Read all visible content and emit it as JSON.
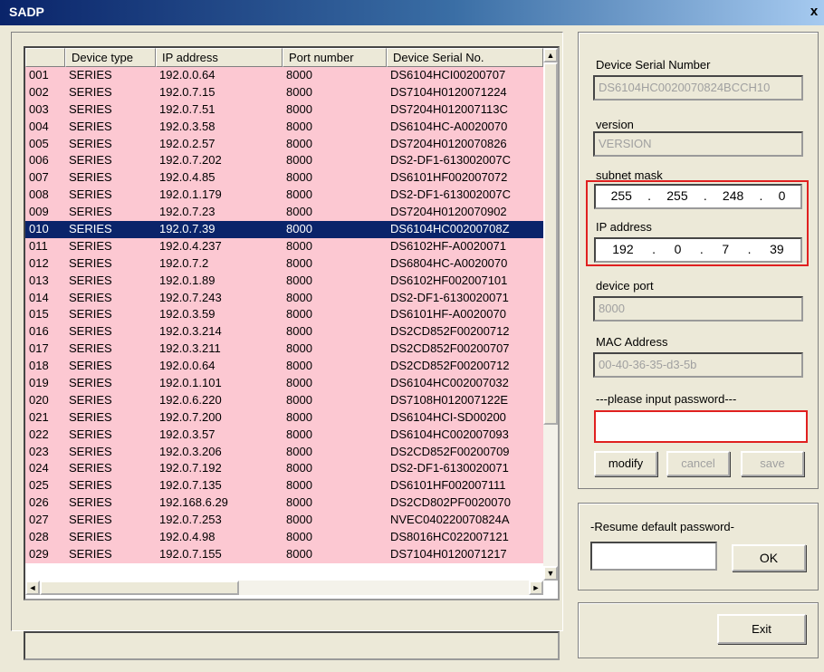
{
  "window": {
    "title": "SADP",
    "close_glyph": "x"
  },
  "table": {
    "columns": [
      "",
      "Device type",
      "IP address",
      "Port number",
      "Device Serial No."
    ],
    "rows": [
      [
        "001",
        "SERIES",
        "192.0.0.64",
        "8000",
        "DS6104HCI00200707"
      ],
      [
        "002",
        "SERIES",
        "192.0.7.15",
        "8000",
        "DS7104H0120071224"
      ],
      [
        "003",
        "SERIES",
        "192.0.7.51",
        "8000",
        "DS7204H012007113C"
      ],
      [
        "004",
        "SERIES",
        "192.0.3.58",
        "8000",
        "DS6104HC-A0020070"
      ],
      [
        "005",
        "SERIES",
        "192.0.2.57",
        "8000",
        "DS7204H0120070826"
      ],
      [
        "006",
        "SERIES",
        "192.0.7.202",
        "8000",
        "DS2-DF1-613002007C"
      ],
      [
        "007",
        "SERIES",
        "192.0.4.85",
        "8000",
        "DS6101HF002007072"
      ],
      [
        "008",
        "SERIES",
        "192.0.1.179",
        "8000",
        "DS2-DF1-613002007C"
      ],
      [
        "009",
        "SERIES",
        "192.0.7.23",
        "8000",
        "DS7204H0120070902"
      ],
      [
        "010",
        "SERIES",
        "192.0.7.39",
        "8000",
        "DS6104HC00200708Z"
      ],
      [
        "011",
        "SERIES",
        "192.0.4.237",
        "8000",
        "DS6102HF-A0020071"
      ],
      [
        "012",
        "SERIES",
        "192.0.7.2",
        "8000",
        "DS6804HC-A0020070"
      ],
      [
        "013",
        "SERIES",
        "192.0.1.89",
        "8000",
        "DS6102HF002007101"
      ],
      [
        "014",
        "SERIES",
        "192.0.7.243",
        "8000",
        "DS2-DF1-6130020071"
      ],
      [
        "015",
        "SERIES",
        "192.0.3.59",
        "8000",
        "DS6101HF-A0020070"
      ],
      [
        "016",
        "SERIES",
        "192.0.3.214",
        "8000",
        "DS2CD852F00200712"
      ],
      [
        "017",
        "SERIES",
        "192.0.3.211",
        "8000",
        "DS2CD852F00200707"
      ],
      [
        "018",
        "SERIES",
        "192.0.0.64",
        "8000",
        "DS2CD852F00200712"
      ],
      [
        "019",
        "SERIES",
        "192.0.1.101",
        "8000",
        "DS6104HC002007032"
      ],
      [
        "020",
        "SERIES",
        "192.0.6.220",
        "8000",
        "DS7108H012007122E"
      ],
      [
        "021",
        "SERIES",
        "192.0.7.200",
        "8000",
        "DS6104HCI-SD00200"
      ],
      [
        "022",
        "SERIES",
        "192.0.3.57",
        "8000",
        "DS6104HC002007093"
      ],
      [
        "023",
        "SERIES",
        "192.0.3.206",
        "8000",
        "DS2CD852F00200709"
      ],
      [
        "024",
        "SERIES",
        "192.0.7.192",
        "8000",
        "DS2-DF1-6130020071"
      ],
      [
        "025",
        "SERIES",
        "192.0.7.135",
        "8000",
        "DS6101HF002007111"
      ],
      [
        "026",
        "SERIES",
        "192.168.6.29",
        "8000",
        "DS2CD802PF0020070"
      ],
      [
        "027",
        "SERIES",
        "192.0.7.253",
        "8000",
        "NVEC040220070824A"
      ],
      [
        "028",
        "SERIES",
        "192.0.4.98",
        "8000",
        "DS8016HC022007121"
      ],
      [
        "029",
        "SERIES",
        "192.0.7.155",
        "8000",
        "DS7104H0120071217"
      ]
    ],
    "selected_row": 9
  },
  "scroll": {
    "up": "▲",
    "down": "▼",
    "left": "◄",
    "right": "►"
  },
  "details": {
    "serial_label": "Device Serial Number",
    "serial_value": "DS6104HC0020070824BCCH10",
    "version_label": "version",
    "version_value": "VERSION",
    "subnet_label": "subnet mask",
    "subnet_octets": [
      "255",
      "255",
      "248",
      "0"
    ],
    "ip_label": "IP address",
    "ip_octets": [
      "192",
      "0",
      "7",
      "39"
    ],
    "port_label": "device port",
    "port_value": "8000",
    "mac_label": "MAC Address",
    "mac_value": "00-40-36-35-d3-5b",
    "password_label": "---please input password---",
    "password_value": "",
    "dot": "."
  },
  "buttons": {
    "modify": "modify",
    "cancel": "cancel",
    "save": "save",
    "ok": "OK",
    "exit": "Exit"
  },
  "resume": {
    "label": "-Resume default password-",
    "value": ""
  },
  "colors": {
    "row_bg": "#fcc8d2",
    "selected_bg": "#0a246a",
    "highlight_border": "#e02020"
  }
}
